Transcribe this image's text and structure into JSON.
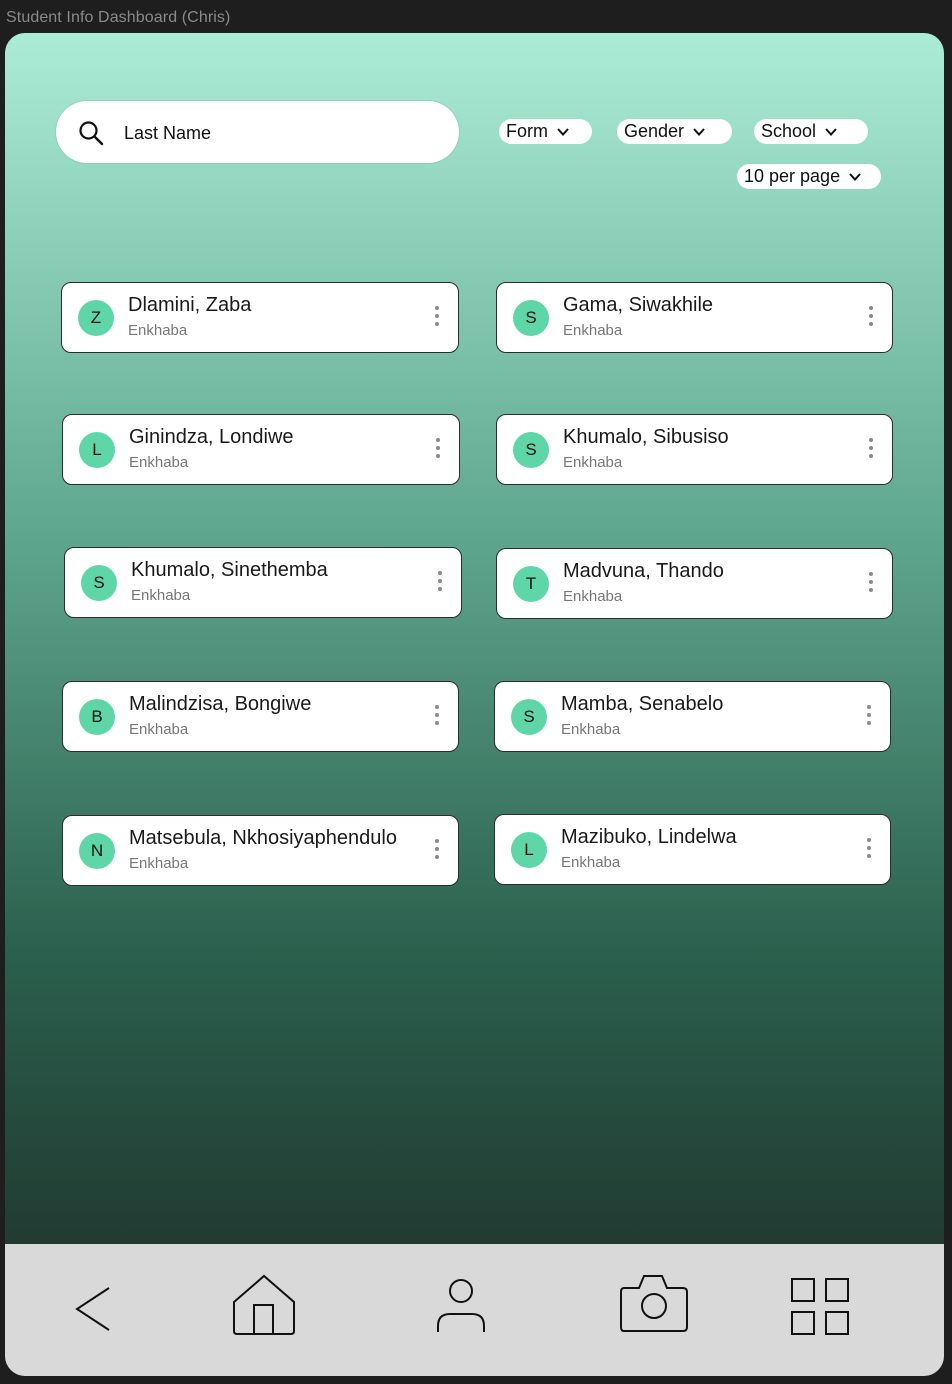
{
  "window": {
    "title": "Student Info Dashboard (Chris)"
  },
  "search": {
    "placeholder": "Last Name",
    "value": ""
  },
  "filters": {
    "form": "Form",
    "gender": "Gender",
    "school": "School",
    "per_page": "10 per page"
  },
  "students": [
    {
      "initial": "Z",
      "name": "Dlamini, Zaba",
      "school": "Enkhaba"
    },
    {
      "initial": "S",
      "name": "Gama, Siwakhile",
      "school": "Enkhaba"
    },
    {
      "initial": "L",
      "name": "Ginindza, Londiwe",
      "school": "Enkhaba"
    },
    {
      "initial": "S",
      "name": "Khumalo, Sibusiso",
      "school": "Enkhaba"
    },
    {
      "initial": "S",
      "name": "Khumalo, Sinethemba",
      "school": "Enkhaba"
    },
    {
      "initial": "T",
      "name": "Madvuna, Thando",
      "school": "Enkhaba"
    },
    {
      "initial": "B",
      "name": "Malindzisa, Bongiwe",
      "school": "Enkhaba"
    },
    {
      "initial": "S",
      "name": "Mamba, Senabelo",
      "school": "Enkhaba"
    },
    {
      "initial": "N",
      "name": "Matsebula, Nkhosiyaphendulo",
      "school": "Enkhaba"
    },
    {
      "initial": "L",
      "name": "Mazibuko, Lindelwa",
      "school": "Enkhaba"
    }
  ],
  "nav": {
    "icons": [
      "back-icon",
      "home-icon",
      "profile-icon",
      "camera-icon",
      "grid-icon"
    ]
  },
  "colors": {
    "avatar": "#5ed6a7",
    "gradient_top": "#abecd6",
    "gradient_bottom": "#1d2a25",
    "nav_bar": "#d9d9d9"
  }
}
